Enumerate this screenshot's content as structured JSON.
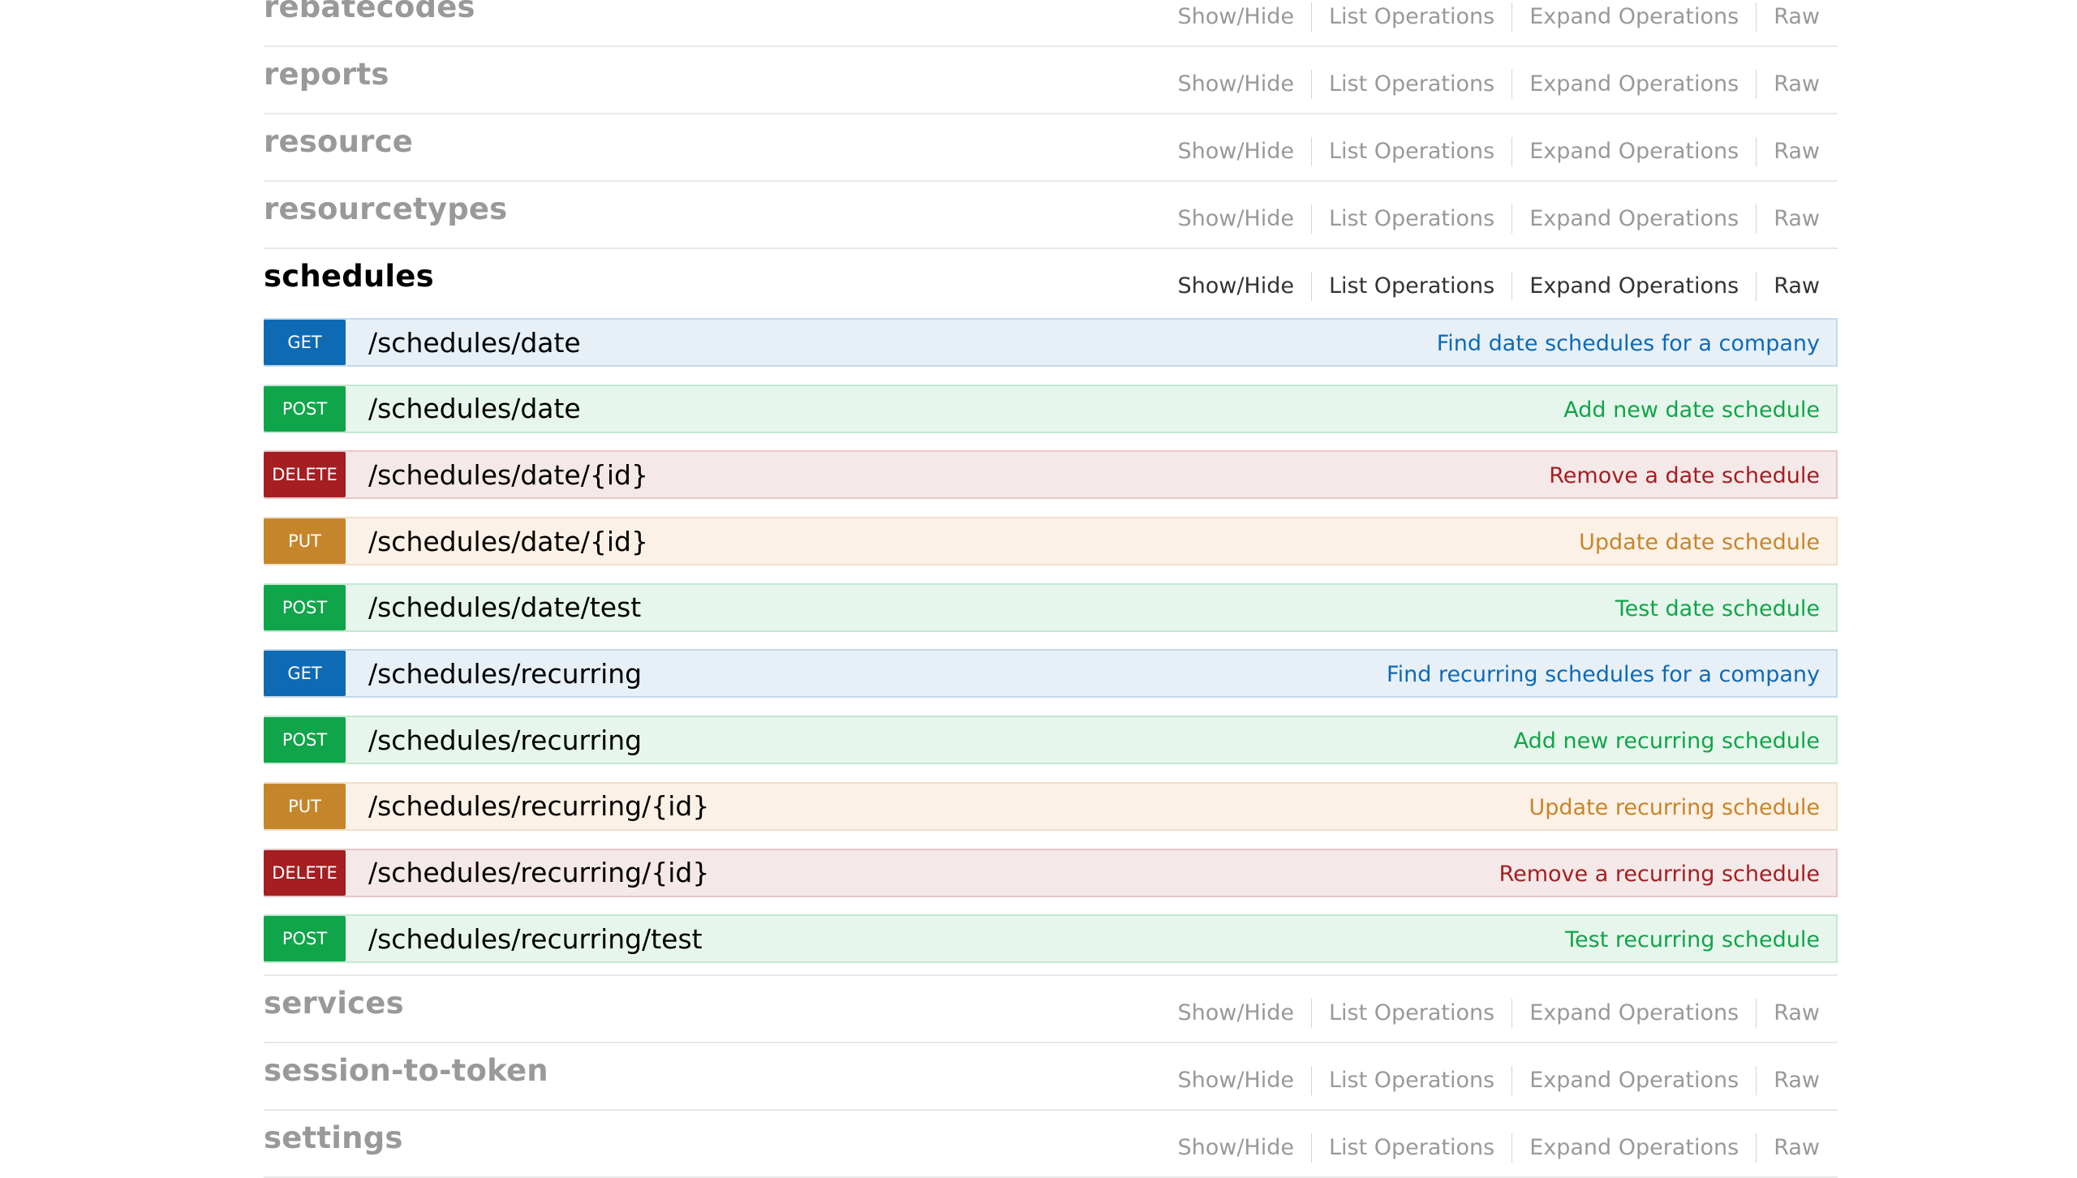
{
  "resources_before": [
    {
      "name": "rebatecodes",
      "options": [
        "Show/Hide",
        "List Operations",
        "Expand Operations",
        "Raw"
      ]
    },
    {
      "name": "reports",
      "options": [
        "Show/Hide",
        "List Operations",
        "Expand Operations",
        "Raw"
      ]
    },
    {
      "name": "resource",
      "options": [
        "Show/Hide",
        "List Operations",
        "Expand Operations",
        "Raw"
      ]
    },
    {
      "name": "resourcetypes",
      "options": [
        "Show/Hide",
        "List Operations",
        "Expand Operations",
        "Raw"
      ]
    }
  ],
  "active_resource": {
    "name": "schedules",
    "options": [
      "Show/Hide",
      "List Operations",
      "Expand Operations",
      "Raw"
    ],
    "operations": [
      {
        "method": "GET",
        "path": "/schedules/date",
        "summary": "Find date schedules for a company"
      },
      {
        "method": "POST",
        "path": "/schedules/date",
        "summary": "Add new date schedule"
      },
      {
        "method": "DELETE",
        "path": "/schedules/date/{id}",
        "summary": "Remove a date schedule"
      },
      {
        "method": "PUT",
        "path": "/schedules/date/{id}",
        "summary": "Update date schedule"
      },
      {
        "method": "POST",
        "path": "/schedules/date/test",
        "summary": "Test date schedule"
      },
      {
        "method": "GET",
        "path": "/schedules/recurring",
        "summary": "Find recurring schedules for a company"
      },
      {
        "method": "POST",
        "path": "/schedules/recurring",
        "summary": "Add new recurring schedule"
      },
      {
        "method": "PUT",
        "path": "/schedules/recurring/{id}",
        "summary": "Update recurring schedule"
      },
      {
        "method": "DELETE",
        "path": "/schedules/recurring/{id}",
        "summary": "Remove a recurring schedule"
      },
      {
        "method": "POST",
        "path": "/schedules/recurring/test",
        "summary": "Test recurring schedule"
      }
    ]
  },
  "resources_after": [
    {
      "name": "services",
      "options": [
        "Show/Hide",
        "List Operations",
        "Expand Operations",
        "Raw"
      ]
    },
    {
      "name": "session-to-token",
      "options": [
        "Show/Hide",
        "List Operations",
        "Expand Operations",
        "Raw"
      ]
    },
    {
      "name": "settings",
      "options": [
        "Show/Hide",
        "List Operations",
        "Expand Operations",
        "Raw"
      ]
    }
  ],
  "colors": {
    "get": "#0f6ab4",
    "post": "#10a54a",
    "delete": "#a41e22",
    "put": "#c5862b",
    "inactive_heading": "#999999"
  }
}
